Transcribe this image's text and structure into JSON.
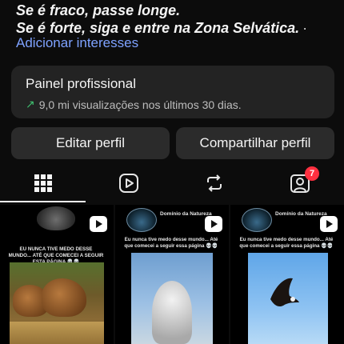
{
  "bio": {
    "line1": "Se é fraco, passe longe.",
    "line2": "Se é forte, siga e entre na Zona Selvática.",
    "trailing": "·",
    "add_interests": "Adicionar interesses"
  },
  "panel": {
    "title": "Painel profissional",
    "subtitle": "9,0 mi visualizações nos últimos 30 dias."
  },
  "buttons": {
    "edit": "Editar perfil",
    "share": "Compartilhar perfil"
  },
  "tabs": {
    "items": [
      "grid",
      "reels",
      "reposts",
      "tagged"
    ],
    "tagged_badge": "7",
    "icons": [
      "grid-icon",
      "reels-icon",
      "repost-icon",
      "tagged-icon"
    ]
  },
  "posts": [
    {
      "caption": "EU NUNCA TIVE MEDO DESSE MUNDO... ATÉ QUE COMECEI A SEGUIR ESTA PÁGINA 💀💀"
    },
    {
      "channel": "Domínio da Natureza",
      "caption": "Eu nunca tive medo desse mundo... Até que comecei a seguir essa página 💀💀"
    },
    {
      "channel": "Domínio da Natureza",
      "caption": "Eu nunca tive medo desse mundo... Até que comecei a seguir essa página 💀💀"
    }
  ],
  "colors": {
    "background": "#0c0c0c",
    "panel": "#232323",
    "button": "#2b2b2b",
    "link": "#7ea2ff",
    "trend_up": "#3fbf6f",
    "badge": "#ff3040"
  }
}
